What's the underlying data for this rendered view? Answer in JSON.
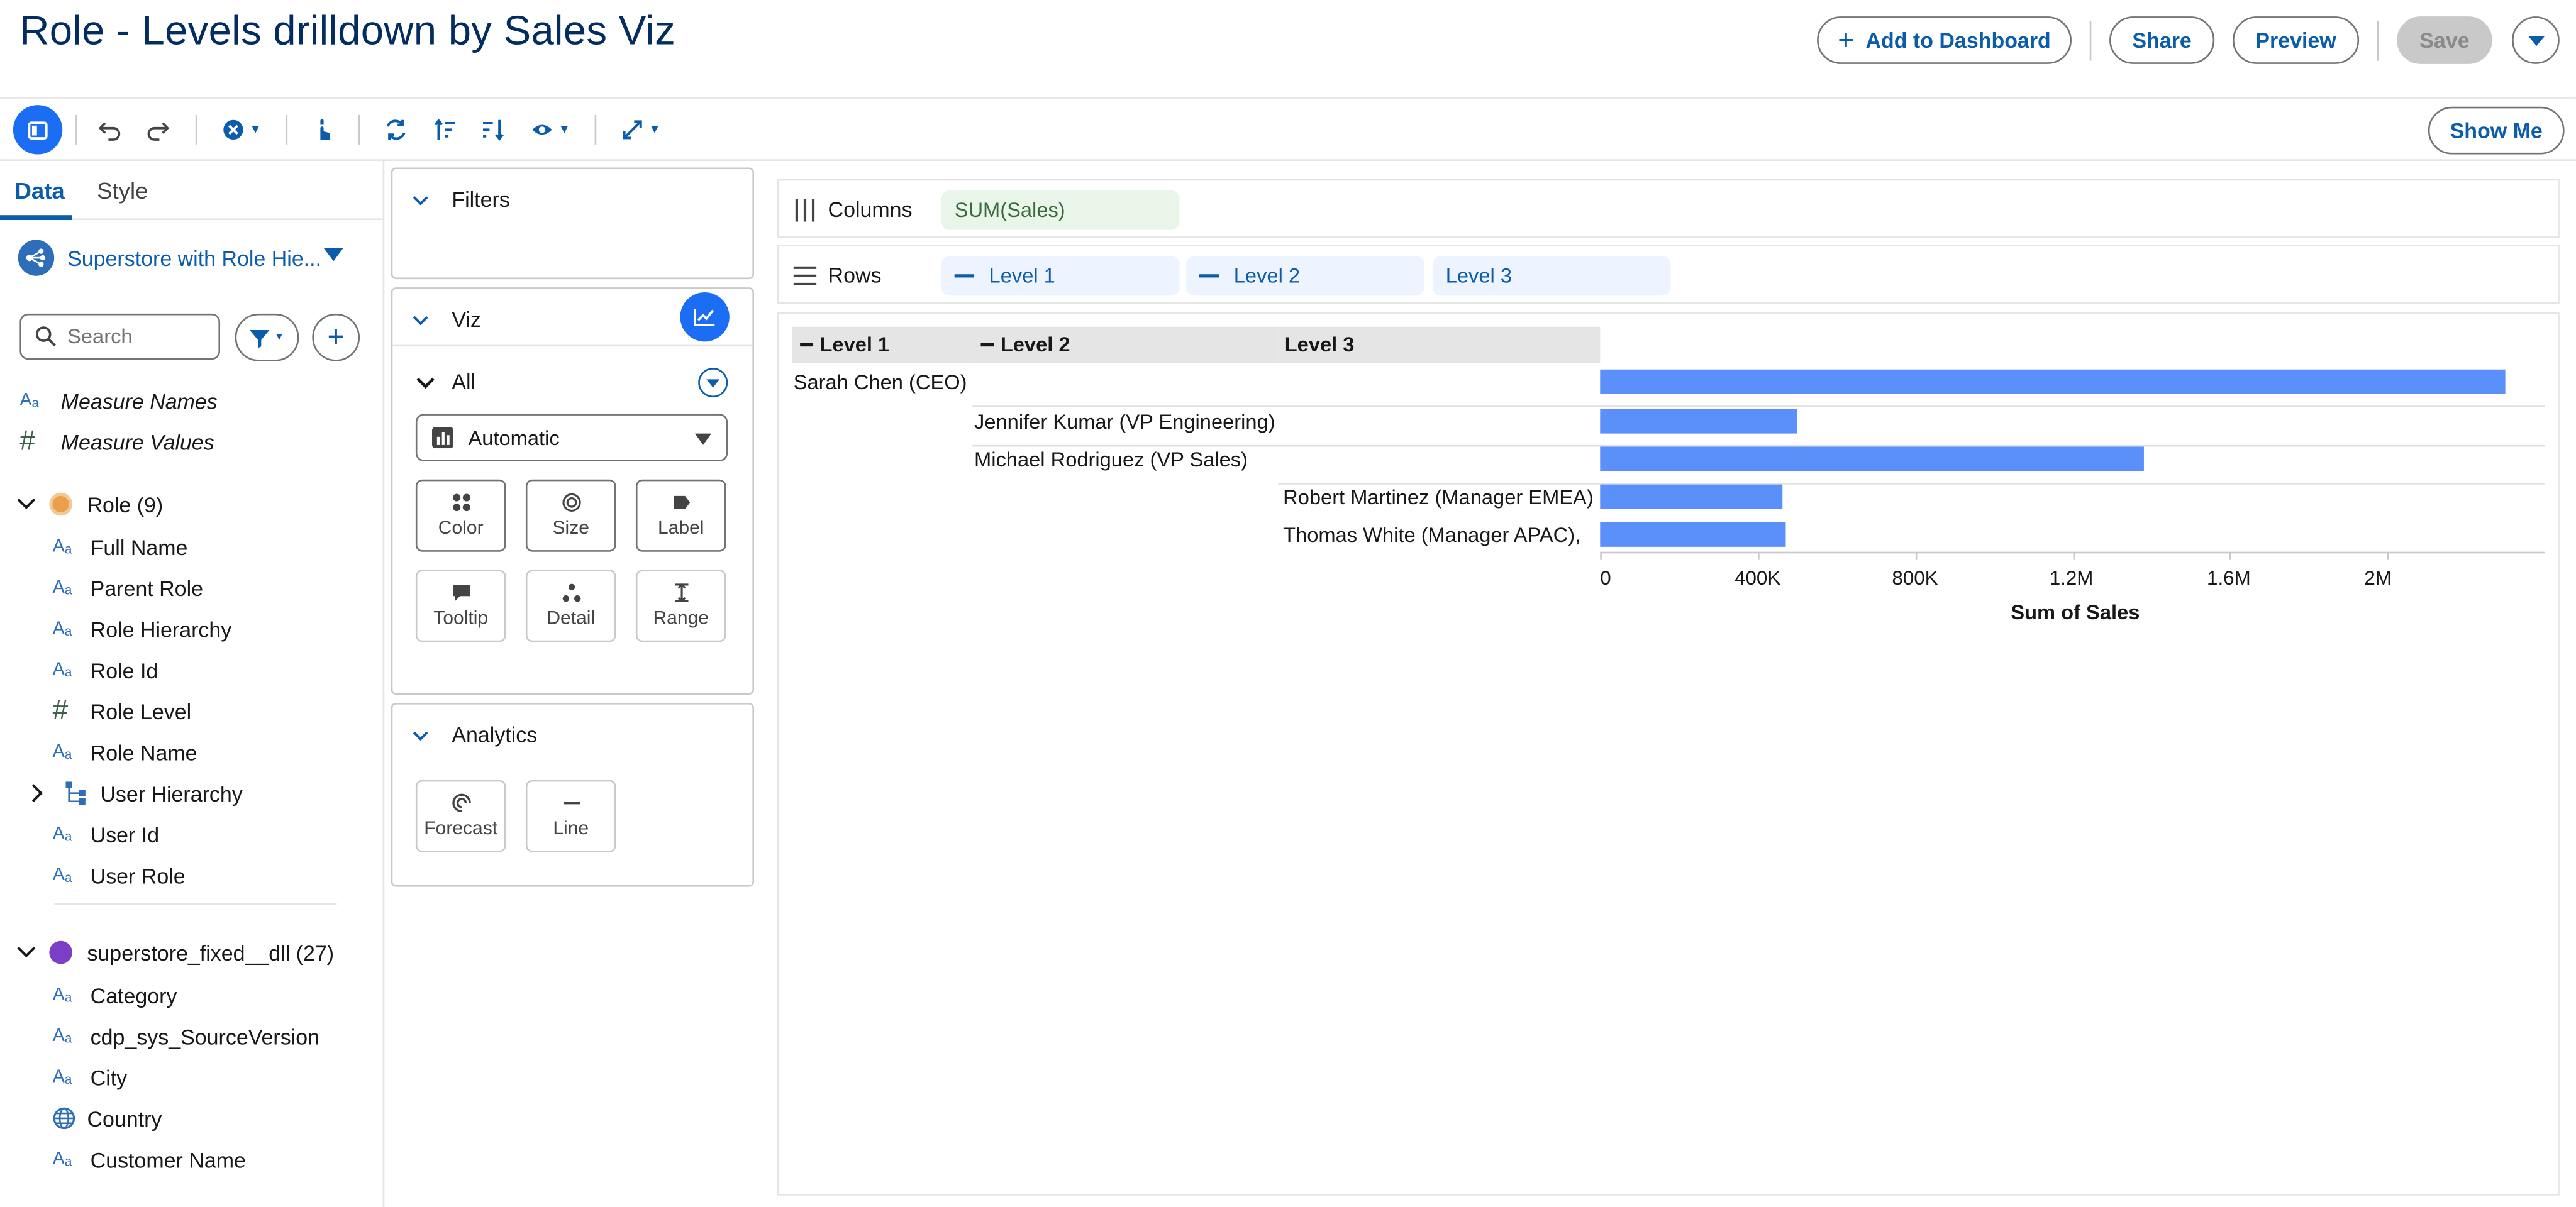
{
  "header": {
    "title": "Role - Levels drilldown by Sales Viz",
    "add_to_dashboard": "Add to Dashboard",
    "share": "Share",
    "preview": "Preview",
    "save": "Save"
  },
  "toolbar": {
    "show_me": "Show Me"
  },
  "left_panel": {
    "tabs": [
      "Data",
      "Style"
    ],
    "datasource": "Superstore with Role Hie...",
    "search_placeholder": "Search",
    "measures": [
      "Measure Names",
      "Measure Values"
    ],
    "role_group": {
      "label": "Role (9)",
      "fields": [
        "Full Name",
        "Parent Role",
        "Role Hierarchy",
        "Role Id",
        "Role Level",
        "Role Name",
        "User Hierarchy",
        "User Id",
        "User Role"
      ]
    },
    "superstore_group": {
      "label": "superstore_fixed__dll (27)",
      "fields": [
        "Category",
        "cdp_sys_SourceVersion",
        "City",
        "Country",
        "Customer Name"
      ]
    }
  },
  "middle_panel": {
    "filters": "Filters",
    "viz": "Viz",
    "all": "All",
    "mark_type": "Automatic",
    "marks": [
      "Color",
      "Size",
      "Label",
      "Tooltip",
      "Detail",
      "Range"
    ],
    "analytics": "Analytics",
    "analytics_items": [
      "Forecast",
      "Line"
    ]
  },
  "shelves": {
    "columns_label": "Columns",
    "columns_pill": "SUM(Sales)",
    "rows_label": "Rows",
    "rows_pills": [
      "Level 1",
      "Level 2",
      "Level 3"
    ]
  },
  "chart_data": {
    "type": "bar",
    "headers": [
      "Level 1",
      "Level 2",
      "Level 3"
    ],
    "rows": [
      {
        "level1": "Sarah Chen (CEO)",
        "level2": "",
        "level3": "",
        "value": 2300000
      },
      {
        "level1": "",
        "level2": "Jennifer Kumar (VP Engineering)",
        "level3": "",
        "value": 500000
      },
      {
        "level1": "",
        "level2": "Michael Rodriguez (VP Sales)",
        "level3": "",
        "value": 1380000
      },
      {
        "level1": "",
        "level2": "",
        "level3": "Robert Martinez (Manager EMEA)",
        "value": 465000
      },
      {
        "level1": "",
        "level2": "",
        "level3": "Thomas White (Manager APAC),",
        "value": 470000
      }
    ],
    "xticks": [
      "0",
      "400K",
      "800K",
      "1.2M",
      "1.6M",
      "2M"
    ],
    "xtick_values": [
      0,
      400000,
      800000,
      1200000,
      1600000,
      2000000
    ],
    "xlim": [
      0,
      2400000
    ],
    "xlabel": "Sum of Sales",
    "bar_color": "#5b8ff9"
  }
}
